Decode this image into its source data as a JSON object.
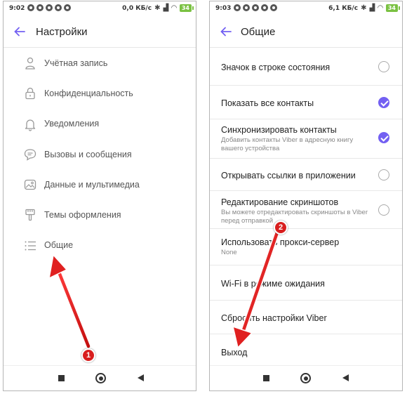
{
  "left": {
    "status": {
      "time": "9:02",
      "speed": "0,0 КБ/с",
      "battery": "34"
    },
    "title": "Настройки",
    "items": [
      {
        "label": "Учётная запись",
        "icon": "person-icon"
      },
      {
        "label": "Конфиденциальность",
        "icon": "lock-icon"
      },
      {
        "label": "Уведомления",
        "icon": "bell-icon"
      },
      {
        "label": "Вызовы и сообщения",
        "icon": "chat-icon"
      },
      {
        "label": "Данные и мультимедиа",
        "icon": "image-icon"
      },
      {
        "label": "Темы оформления",
        "icon": "brush-icon"
      },
      {
        "label": "Общие",
        "icon": "list-icon"
      }
    ],
    "badge": "1"
  },
  "right": {
    "status": {
      "time": "9:03",
      "speed": "6,1 КБ/с",
      "battery": "34"
    },
    "title": "Общие",
    "items": [
      {
        "title": "Значок в строке состояния",
        "checked": false
      },
      {
        "title": "Показать все контакты",
        "checked": true
      },
      {
        "title": "Синхронизировать контакты",
        "subtitle": "Добавить контакты Viber в адресную книгу вашего устройства",
        "checked": true
      },
      {
        "title": "Открывать ссылки в приложении",
        "checked": false
      },
      {
        "title": "Редактирование скриншотов",
        "subtitle": "Вы можете отредактировать скриншоты в Viber перед отправкой",
        "checked": false
      },
      {
        "title": "Использовать прокси-сервер",
        "subtitle": "None"
      },
      {
        "title": "Wi-Fi в режиме ожидания"
      },
      {
        "title": "Сбросить настройки Viber"
      },
      {
        "title": "Выход"
      }
    ],
    "badge": "2"
  },
  "colors": {
    "accent": "#7360f2",
    "arrow": "#e02020",
    "battery": "#7ac142"
  }
}
